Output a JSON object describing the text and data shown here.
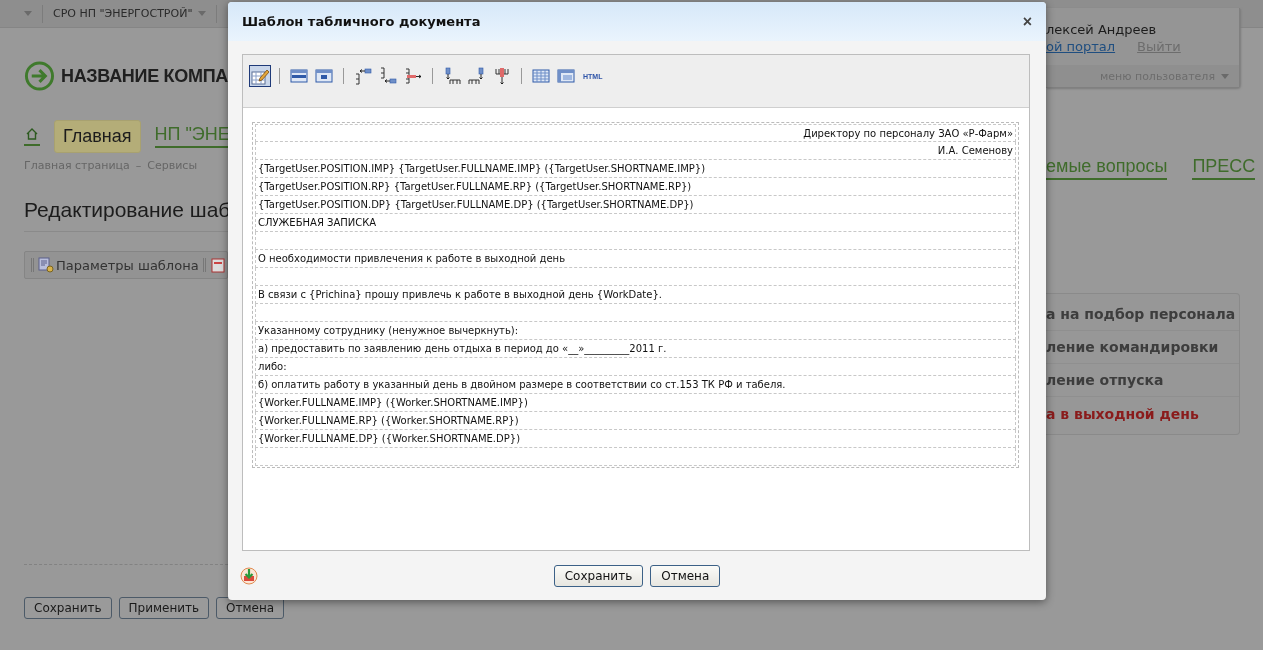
{
  "top_bar": {
    "menu_label": "СРО НП \"ЭНЕРГОСТРОЙ\""
  },
  "logo": {
    "text": "НАЗВАНИЕ КОМПА"
  },
  "nav": [
    {
      "kind": "home",
      "selected": false
    },
    {
      "kind": "link",
      "label": "Главная",
      "selected": true
    },
    {
      "kind": "link",
      "label": "НП \"ЭНЕ",
      "selected": false
    }
  ],
  "breadcrumb": {
    "items": [
      "Главная страница",
      "Сервисы"
    ],
    "separator": "–"
  },
  "heading": "Редактирование шаб",
  "template_toolbar": [
    {
      "label": "Параметры шаблона"
    }
  ],
  "form_buttons": [
    "Сохранить",
    "Применить",
    "Отмена"
  ],
  "user": {
    "name": "лексей Андреев",
    "links": [
      {
        "kind": "primary",
        "label": "ой портал"
      },
      {
        "kind": "muted",
        "label": "Выйти"
      }
    ],
    "menu_label": "меню пользователя"
  },
  "right_nav": [
    {
      "label": "емые вопросы"
    },
    {
      "label": "ПРЕСС"
    }
  ],
  "services": [
    {
      "label": "а на подбор персонала",
      "selected": false
    },
    {
      "label": "ление командировки",
      "selected": false
    },
    {
      "label": "ление отпуска",
      "selected": false
    },
    {
      "label": "а в выходной день",
      "selected": true
    }
  ],
  "dialog": {
    "title": "Шаблон табличного документа",
    "close": "×",
    "toolbar": [
      {
        "kind": "edit",
        "selected": true
      },
      {
        "kind": "separator"
      },
      {
        "kind": "row-table",
        "selected": false
      },
      {
        "kind": "cell-table",
        "selected": false
      },
      {
        "kind": "separator"
      },
      {
        "kind": "row-above",
        "selected": false
      },
      {
        "kind": "row-below",
        "selected": false
      },
      {
        "kind": "row-delete",
        "selected": false
      },
      {
        "kind": "separator"
      },
      {
        "kind": "col-left",
        "selected": false
      },
      {
        "kind": "col-right",
        "selected": false
      },
      {
        "kind": "col-delete",
        "selected": false
      },
      {
        "kind": "separator"
      },
      {
        "kind": "grid",
        "selected": false
      },
      {
        "kind": "table-props",
        "selected": false
      },
      {
        "kind": "text",
        "label": "HTML",
        "selected": false
      }
    ],
    "rows": [
      {
        "right_aligned": true,
        "text": "Директору по персоналу ЗАО «Р-Фарм»"
      },
      {
        "right_aligned": true,
        "text": "И.А. Семенову"
      },
      {
        "right_aligned": false,
        "text": "{TargetUser.POSITION.IMP} {TargetUser.FULLNAME.IMP} ({TargetUser.SHORTNAME.IMP})"
      },
      {
        "right_aligned": false,
        "text": "{TargetUser.POSITION.RP} {TargetUser.FULLNAME.RP} ({TargetUser.SHORTNAME.RP})"
      },
      {
        "right_aligned": false,
        "text": "{TargetUser.POSITION.DP} {TargetUser.FULLNAME.DP} ({TargetUser.SHORTNAME.DP})"
      },
      {
        "right_aligned": false,
        "text": "СЛУЖЕБНАЯ ЗАПИСКА",
        "blank_row_after": true
      },
      {
        "right_aligned": false,
        "text": "О необходимости привлечения к работе в выходной день",
        "blank_row_after": true
      },
      {
        "right_aligned": false,
        "text": "В связи с {Prichina} прошу привлечь к работе в выходной день {WorkDate}.",
        "blank_row_after": true
      },
      {
        "right_aligned": false,
        "text": "Указанному сотруднику (ненужное вычеркнуть):"
      },
      {
        "right_aligned": false,
        "text": "а) предоставить по заявлению день отдыха в период до  «__»_________2011 г."
      },
      {
        "right_aligned": false,
        "text": "либо:"
      },
      {
        "right_aligned": false,
        "text": "б) оплатить работу в указанный день в двойном размере в соответствии со ст.153 ТК РФ и табеля."
      },
      {
        "right_aligned": false,
        "text": "{Worker.FULLNAME.IMP} ({Worker.SHORTNAME.IMP})"
      },
      {
        "right_aligned": false,
        "text": "{Worker.FULLNAME.RP} ({Worker.SHORTNAME.RP})"
      },
      {
        "right_aligned": false,
        "text": "{Worker.FULLNAME.DP} ({Worker.SHORTNAME.DP})",
        "blank_row_after": true
      }
    ],
    "buttons": [
      "Сохранить",
      "Отмена"
    ]
  }
}
